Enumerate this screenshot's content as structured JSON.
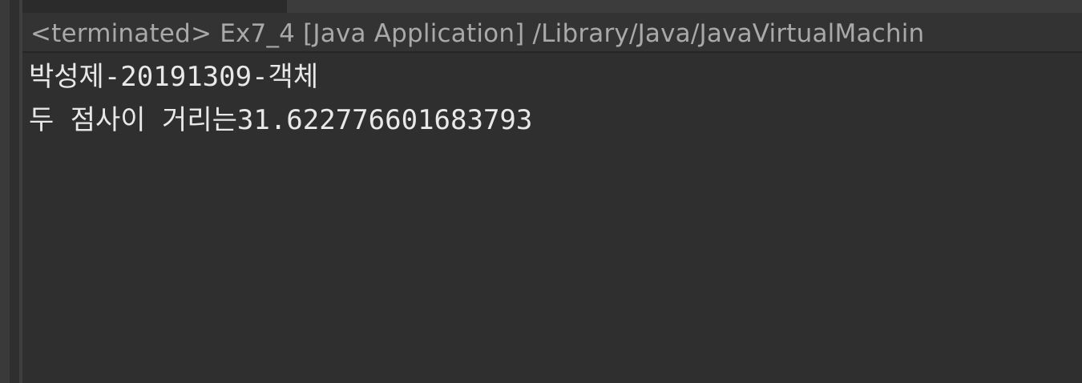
{
  "console": {
    "header": {
      "title": "<terminated> Ex7_4 [Java Application] /Library/Java/JavaVirtualMachin"
    },
    "output": [
      "박성제-20191309-객체",
      "두 점사이 거리는31.622776601683793"
    ]
  },
  "colors": {
    "background": "#2f2f2f",
    "header_background": "#333333",
    "header_text": "#a9a9a9",
    "output_text": "#e8e8e8"
  }
}
